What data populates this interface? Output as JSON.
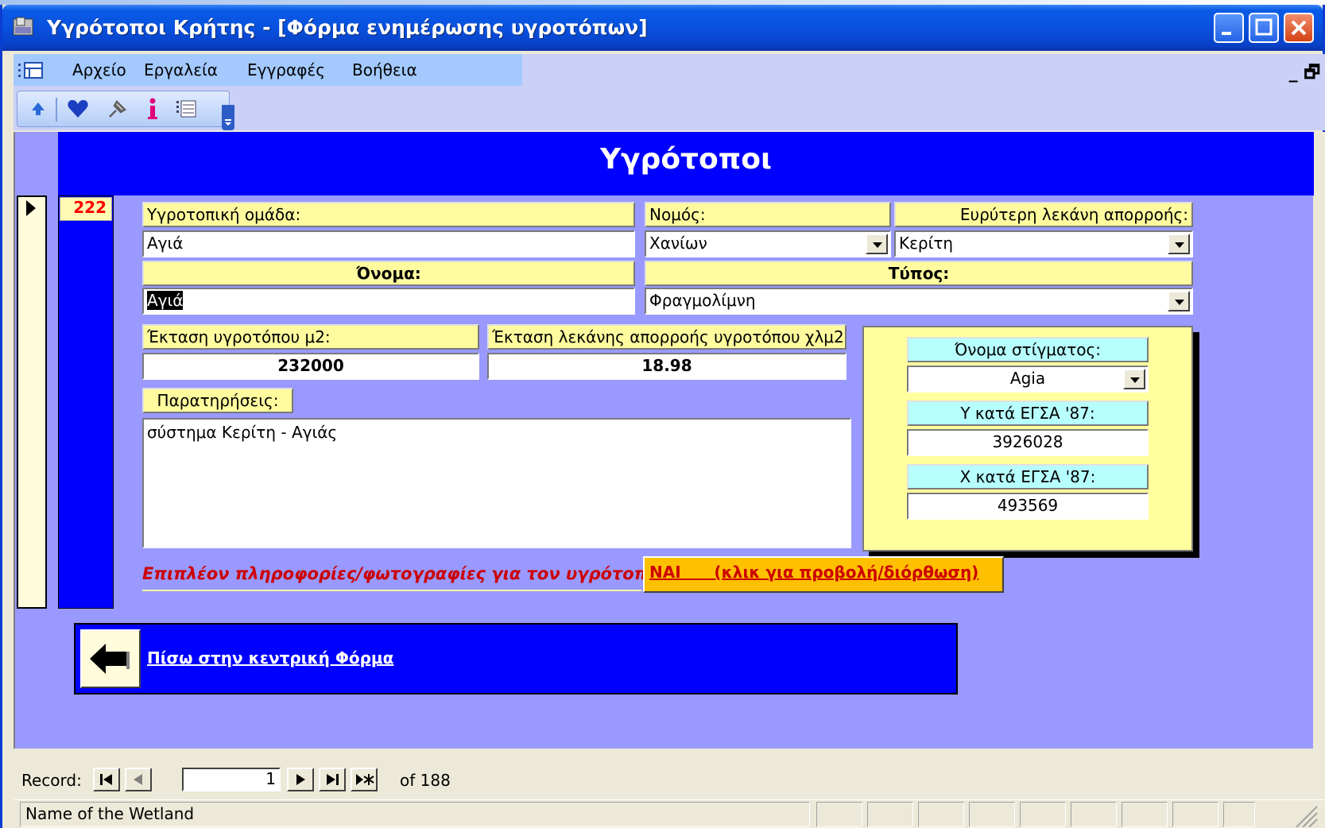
{
  "window": {
    "title": "Υγρότοποι Κρήτης - [Φόρμα ενημέρωσης υγροτόπων]"
  },
  "menu": {
    "items": [
      "Αρχείο",
      "Εργαλεία",
      "Εγγραφές",
      "Βοήθεια"
    ],
    "mdi_controls": "_ 🗗"
  },
  "toolbar": {
    "icons": [
      "up-arrow-icon",
      "heart-icon",
      "pin-icon",
      "info-icon",
      "list-icon"
    ]
  },
  "form": {
    "title": "Υγρότοποι",
    "record_id": "222",
    "wetland_group_label": "Υγροτοπική ομάδα:",
    "wetland_group_value": "Αγιά",
    "prefecture_label": "Νομός:",
    "prefecture_value": "Χανίων",
    "basin_label": "Ευρύτερη λεκάνη απορροής:",
    "basin_value": "Κερίτη",
    "name_label": "Όνομα:",
    "name_value": "Αγιά",
    "type_label": "Τύπος:",
    "type_value": "Φραγμολίμνη",
    "area_label": "Έκταση υγροτόπου μ2:",
    "area_value": "232000",
    "basin_area_label": "Έκταση λεκάνης απορροής υγροτόπου χλμ2:",
    "basin_area_value": "18.98",
    "notes_label": "Παρατηρήσεις:",
    "notes_value": "σύστημα Κερίτη - Αγιάς",
    "point_name_label": "Όνομα στίγματος:",
    "point_name_value": "Agia",
    "y_label": "Υ κατά ΕΓΣΑ '87:",
    "y_value": "3926028",
    "x_label": "Χ κατά ΕΓΣΑ '87:",
    "x_value": "493569",
    "more_info_label": "Επιπλέον πληροφορίες/φωτογραφίες  για τον υγρότοπο",
    "more_info_button": "ΝΑΙ      (κλικ για προβολή/διόρθωση)",
    "back_link": "Πίσω στην κεντρική Φόρμα"
  },
  "navigation": {
    "label": "Record:",
    "current": "1",
    "of_text": "of  188"
  },
  "status": {
    "text": "Name of the Wetland"
  }
}
